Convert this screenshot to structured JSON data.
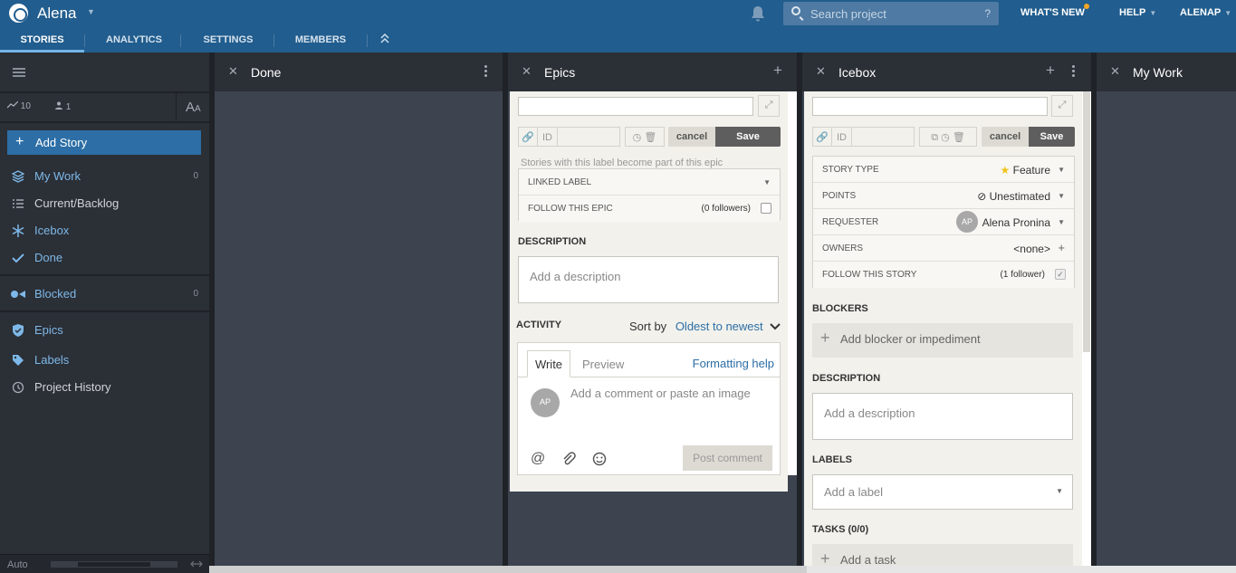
{
  "header": {
    "project_name": "Alena",
    "search_placeholder": "Search project",
    "search_help": "?",
    "whats_new": "WHAT'S NEW",
    "help": "HELP",
    "user": "ALENAP",
    "colors": {
      "topbar": "#215d8e",
      "accent": "#2c6ea5"
    }
  },
  "tabs": [
    {
      "label": "STORIES",
      "active": true
    },
    {
      "label": "ANALYTICS"
    },
    {
      "label": "SETTINGS"
    },
    {
      "label": "MEMBERS"
    }
  ],
  "sidebar": {
    "velocity": "10",
    "members": "1",
    "font_toggle": "A",
    "font_toggle_small": "A",
    "add_story": "Add Story",
    "items": [
      {
        "label": "My Work",
        "count": "0",
        "icon": "layers-icon"
      },
      {
        "label": "Current/Backlog",
        "icon": "list-icon"
      },
      {
        "label": "Icebox",
        "icon": "snowflake-icon"
      },
      {
        "label": "Done",
        "icon": "check-icon"
      },
      {
        "label": "Blocked",
        "count": "0",
        "icon": "blocked-icon"
      },
      {
        "label": "Epics",
        "icon": "shield-icon"
      },
      {
        "label": "Labels",
        "icon": "tag-icon"
      },
      {
        "label": "Project History",
        "icon": "clock-icon"
      }
    ],
    "footer_auto": "Auto"
  },
  "panels": {
    "done": {
      "title": "Done"
    },
    "epics": {
      "title": "Epics",
      "id_label": "ID",
      "cancel": "cancel",
      "save": "Save",
      "hint": "Stories with this label become part of this epic",
      "linked_label": "LINKED LABEL",
      "follow_label": "FOLLOW THIS EPIC",
      "followers": "(0 followers)",
      "description_heading": "DESCRIPTION",
      "description_placeholder": "Add a description",
      "activity_heading": "ACTIVITY",
      "sort_by": "Sort by",
      "sort_value": "Oldest to newest",
      "write_tab": "Write",
      "preview_tab": "Preview",
      "formatting_help": "Formatting help",
      "avatar_initials": "AP",
      "comment_placeholder": "Add a comment or paste an image",
      "post_comment": "Post comment"
    },
    "icebox": {
      "title": "Icebox",
      "id_label": "ID",
      "cancel": "cancel",
      "save": "Save",
      "rows": [
        {
          "label": "STORY TYPE",
          "value": "Feature"
        },
        {
          "label": "POINTS",
          "value": "Unestimated"
        },
        {
          "label": "REQUESTER",
          "value": "Alena Pronina",
          "avatar": "AP"
        },
        {
          "label": "OWNERS",
          "value": "<none>"
        },
        {
          "label": "FOLLOW THIS STORY",
          "value": "(1 follower)",
          "checked": true
        }
      ],
      "blockers_heading": "BLOCKERS",
      "add_blocker": "Add blocker or impediment",
      "description_heading": "DESCRIPTION",
      "description_placeholder": "Add a description",
      "labels_heading": "LABELS",
      "labels_placeholder": "Add a label",
      "tasks_heading": "TASKS (0/0)",
      "add_task": "Add a task"
    },
    "mywork": {
      "title": "My Work"
    }
  }
}
